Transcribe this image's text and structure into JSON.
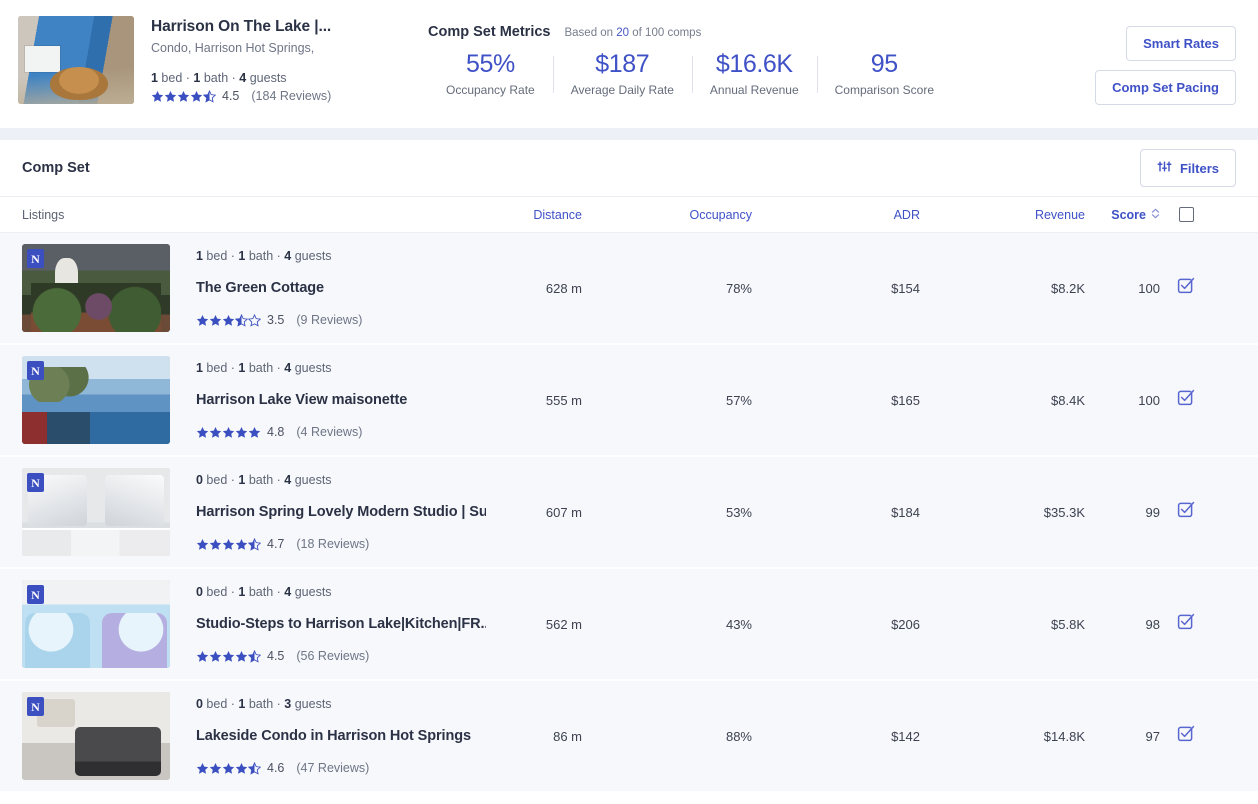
{
  "header": {
    "listing_title": "Harrison On The Lake |...",
    "listing_subtitle": "Condo, Harrison Hot Springs,",
    "specs": {
      "beds": "1",
      "beds_label": " bed",
      "baths": "1",
      "baths_label": " bath",
      "guests": "4",
      "guests_label": " guests"
    },
    "rating_value": "4.5",
    "rating_stars": 4.5,
    "reviews": "(184 Reviews)",
    "metrics_title": "Comp Set Metrics",
    "metrics_basis_prefix": "Based on ",
    "metrics_basis_count": "20",
    "metrics_basis_suffix": " of 100 comps",
    "metrics": [
      {
        "value": "55%",
        "label": "Occupancy Rate"
      },
      {
        "value": "$187",
        "label": "Average Daily Rate"
      },
      {
        "value": "$16.6K",
        "label": "Annual Revenue"
      },
      {
        "value": "95",
        "label": "Comparison Score"
      }
    ],
    "actions": [
      {
        "label": "Smart Rates"
      },
      {
        "label": "Comp Set Pacing"
      }
    ]
  },
  "comp_set": {
    "title": "Comp Set",
    "filters_label": "Filters",
    "columns": {
      "listings": "Listings",
      "distance": "Distance",
      "occupancy": "Occupancy",
      "adr": "ADR",
      "revenue": "Revenue",
      "score": "Score"
    },
    "select_all_checked": false,
    "rows": [
      {
        "specs": {
          "beds": "1",
          "beds_label": " bed",
          "baths": "1",
          "baths_label": " bath",
          "guests": "4",
          "guests_label": " guests"
        },
        "name": "The Green Cottage",
        "rating_value": "3.5",
        "rating_stars": 3.5,
        "reviews": "(9 Reviews)",
        "distance": "628 m",
        "occupancy": "78%",
        "adr": "$154",
        "revenue": "$8.2K",
        "score": "100",
        "selected": true,
        "source_badge": "N",
        "art": "art-cottage"
      },
      {
        "specs": {
          "beds": "1",
          "beds_label": " bed",
          "baths": "1",
          "baths_label": " bath",
          "guests": "4",
          "guests_label": " guests"
        },
        "name": "Harrison Lake View maisonette",
        "rating_value": "4.8",
        "rating_stars": 5,
        "reviews": "(4 Reviews)",
        "distance": "555 m",
        "occupancy": "57%",
        "adr": "$165",
        "revenue": "$8.4K",
        "score": "100",
        "selected": true,
        "source_badge": "N",
        "art": "art-lake"
      },
      {
        "specs": {
          "beds": "0",
          "beds_label": " bed",
          "baths": "1",
          "baths_label": " bath",
          "guests": "4",
          "guests_label": " guests"
        },
        "name": "Harrison Spring Lovely Modern Studio | Sui...",
        "rating_value": "4.7",
        "rating_stars": 4.5,
        "reviews": "(18 Reviews)",
        "distance": "607 m",
        "occupancy": "53%",
        "adr": "$184",
        "revenue": "$35.3K",
        "score": "99",
        "selected": true,
        "source_badge": "N",
        "art": "art-studio"
      },
      {
        "specs": {
          "beds": "0",
          "beds_label": " bed",
          "baths": "1",
          "baths_label": " bath",
          "guests": "4",
          "guests_label": " guests"
        },
        "name": "Studio-Steps to Harrison Lake|Kitchen|FR...",
        "rating_value": "4.5",
        "rating_stars": 4.5,
        "reviews": "(56 Reviews)",
        "distance": "562 m",
        "occupancy": "43%",
        "adr": "$206",
        "revenue": "$5.8K",
        "score": "98",
        "selected": true,
        "source_badge": "N",
        "art": "art-blue"
      },
      {
        "specs": {
          "beds": "0",
          "beds_label": " bed",
          "baths": "1",
          "baths_label": " bath",
          "guests": "3",
          "guests_label": " guests"
        },
        "name": "Lakeside Condo in Harrison Hot Springs",
        "rating_value": "4.6",
        "rating_stars": 4.5,
        "reviews": "(47 Reviews)",
        "distance": "86 m",
        "occupancy": "88%",
        "adr": "$142",
        "revenue": "$14.8K",
        "score": "97",
        "selected": true,
        "source_badge": "N",
        "art": "art-condo"
      }
    ]
  },
  "colors": {
    "accent": "#3f51c6",
    "star": "#3b4fc0",
    "text": "#2b3245",
    "muted": "#6e7585",
    "page_bg": "#eef0f8",
    "row_bg": "#f7f8fc"
  }
}
